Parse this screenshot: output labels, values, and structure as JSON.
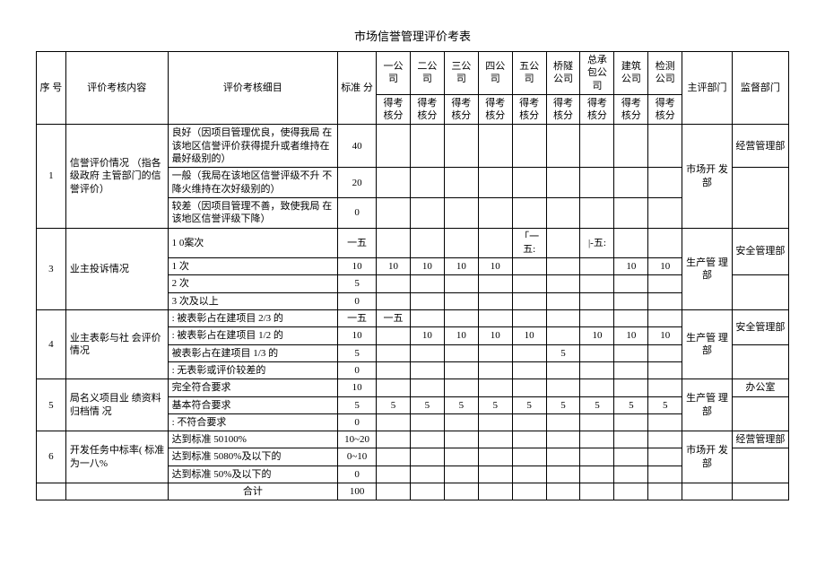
{
  "title": "市场信誉管理评价考表",
  "header": {
    "seq": "序 号",
    "content": "评价考核内容",
    "detail": "评价考核细目",
    "std": "标准 分",
    "companies": [
      "一公司",
      "二公司",
      "三公司",
      "四公 司",
      "五公 司",
      "桥隧 公司",
      "总承 包公 司",
      "建筑公司",
      "检测 公司"
    ],
    "score": "得考核分",
    "dept": "主评部门",
    "super": "监督部门"
  },
  "row1": {
    "num": "1",
    "content": "信誉评价情况 （指各级政府 主管部门的信 誉评价）",
    "d1": "良好（因项目管理优良，使得我局 在该地区信誉评价获得提升或者维持在最好级别的）",
    "s1": "40",
    "d2": "一般（我局在该地区信誉评级不升 不降火维持在次好级别的）",
    "s2": "20",
    "d3": "较差（因项目管理不善，致使我局 在该地区信誉评级下降）",
    "s3": "0",
    "dept": "市场开 发部",
    "super": "经营管理部"
  },
  "row3": {
    "num": "3",
    "content": "业主投诉情况",
    "d1": "1 0案次",
    "s1": "一五",
    "d2": "1 次",
    "s2": "10",
    "d3": "2 次",
    "s3": "5",
    "d4": "3 次及以上",
    "s4": "0",
    "v_c5": "「一五:",
    "v_c7": "|-五:",
    "v10": "10",
    "dept": "生产管 理部",
    "super": "安全管理部"
  },
  "row4": {
    "num": "4",
    "content": "业主表彰与社 会评价情况",
    "d1": ": 被表彰占在建项目 2/3 的",
    "s1": "一五",
    "v1_c1": "一五",
    "d2": ": 被表彰占在建项目 1/2 的",
    "s2": "10",
    "d3": "被表彰占在建项目 1/3 的",
    "s3": "5",
    "v3_c6": "5",
    "d4": ": 无表彰或评价较差的",
    "s4": "0",
    "v10": "10",
    "dept": "生产管 理部",
    "super": "安全管理部"
  },
  "row5": {
    "num": "5",
    "content": "局名义项目业 绩资料归档情 况",
    "d1": "完全符合要求",
    "s1": "10",
    "d2": "基本符合要求",
    "s2": "5",
    "v5": "5",
    "d3": ": 不符合要求",
    "s3": "0",
    "dept": "生产管 理部",
    "super": "办公室"
  },
  "row6": {
    "num": "6",
    "content": "开发任务中标率( 标准为一八%",
    "d1": "达到标准 50100%",
    "s1": "10~20",
    "d2": "达到标准 5080%及以下的",
    "s2": "0~10",
    "d3": "达到标准 50%及以下的",
    "s3": "0",
    "dept": "市场开 发部",
    "super": "经营管理部"
  },
  "total": {
    "label": "合计",
    "value": "100"
  }
}
